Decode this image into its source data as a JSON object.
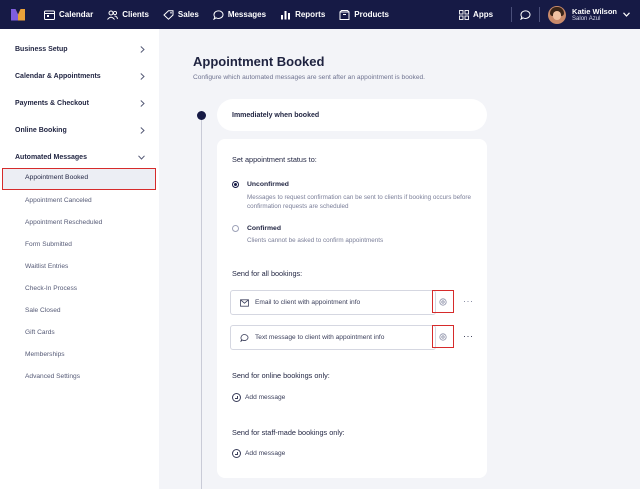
{
  "nav": {
    "items": [
      {
        "label": "Calendar",
        "icon": "calendar-icon"
      },
      {
        "label": "Clients",
        "icon": "users-icon"
      },
      {
        "label": "Sales",
        "icon": "tag-icon"
      },
      {
        "label": "Messages",
        "icon": "chat-icon"
      },
      {
        "label": "Reports",
        "icon": "bar-chart-icon"
      },
      {
        "label": "Products",
        "icon": "box-icon"
      }
    ],
    "apps_label": "Apps",
    "user_name": "Katie Wilson",
    "user_salon": "Salon Azul"
  },
  "sidebar": {
    "groups": [
      {
        "label": "Business Setup"
      },
      {
        "label": "Calendar & Appointments"
      },
      {
        "label": "Payments & Checkout"
      },
      {
        "label": "Online Booking"
      },
      {
        "label": "Automated Messages"
      }
    ],
    "active_item": "Appointment Booked",
    "sub_items": [
      "Appointment Canceled",
      "Appointment Rescheduled",
      "Form Submitted",
      "Waitlist Entries",
      "Check-In Process",
      "Sale Closed",
      "Gift Cards",
      "Memberships",
      "Advanced Settings"
    ]
  },
  "main": {
    "title": "Appointment Booked",
    "subtitle": "Configure which automated messages are sent after an appointment is booked.",
    "trigger_label": "Immediately when booked",
    "status_heading": "Set appointment status to:",
    "status_options": [
      {
        "title": "Unconfirmed",
        "description": "Messages to request confirmation can be sent to clients if booking occurs before confirmation requests are scheduled",
        "selected": true
      },
      {
        "title": "Confirmed",
        "description": "Clients cannot be asked to confirm appointments",
        "selected": false
      }
    ],
    "all_bookings_heading": "Send for all bookings:",
    "messages": [
      {
        "label": "Email to client with appointment info",
        "icon": "mail-icon"
      },
      {
        "label": "Text message to client with appointment info",
        "icon": "sms-icon"
      }
    ],
    "online_heading": "Send for online bookings only:",
    "staff_heading": "Send for staff-made bookings only:",
    "add_message_label": "Add message"
  },
  "colors": {
    "nav_bg": "#161a45",
    "highlight_red": "#d62b2b",
    "page_bg": "#f3f4f8"
  }
}
